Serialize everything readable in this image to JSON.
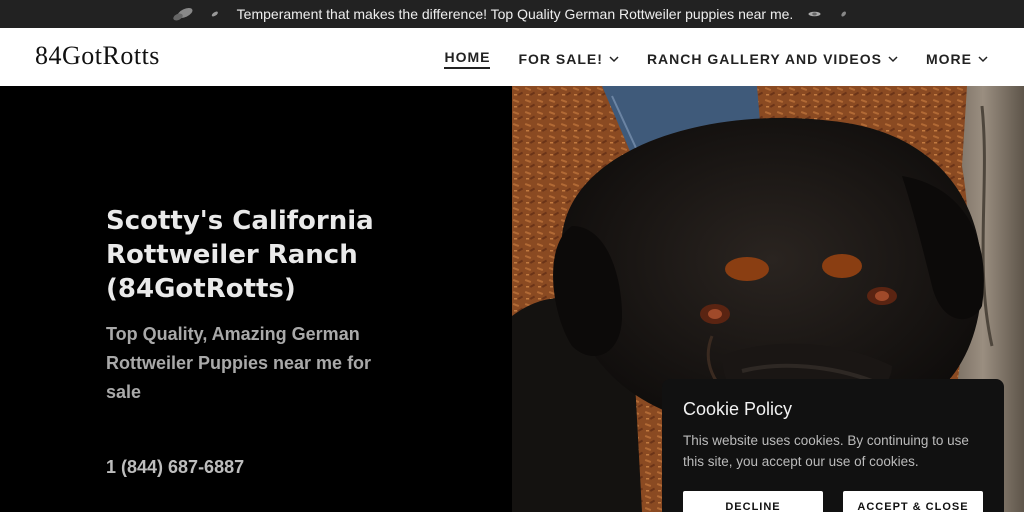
{
  "announcement": {
    "text": "Temperament that makes the difference! Top Quality German Rottweiler puppies near me.",
    "icons": [
      "leaf-icon",
      "leaf-icon",
      "leaf-icon",
      "leaf-icon"
    ]
  },
  "header": {
    "logo": "84GotRotts",
    "menu": [
      {
        "label": "HOME",
        "active": true,
        "dropdown": false
      },
      {
        "label": "FOR SALE!",
        "active": false,
        "dropdown": true
      },
      {
        "label": "RANCH GALLERY AND VIDEOS",
        "active": false,
        "dropdown": true
      },
      {
        "label": "MORE",
        "active": false,
        "dropdown": true
      }
    ]
  },
  "hero": {
    "title": "Scotty's California Rottweiler Ranch (84GotRotts)",
    "subtitle": "Top Quality, Amazing German Rottweiler Puppies near me for sale",
    "phone": "1 (844) 687-6887",
    "image_subject": "rottweiler-photo"
  },
  "cookie": {
    "title": "Cookie Policy",
    "text": "This website uses cookies. By continuing to use this site, you accept our use of cookies.",
    "decline_label": "DECLINE",
    "accept_label": "ACCEPT & CLOSE"
  },
  "colors": {
    "announce_bg": "#222222",
    "nav_bg": "#ffffff",
    "hero_bg": "#000000",
    "cookie_bg": "#111111"
  }
}
